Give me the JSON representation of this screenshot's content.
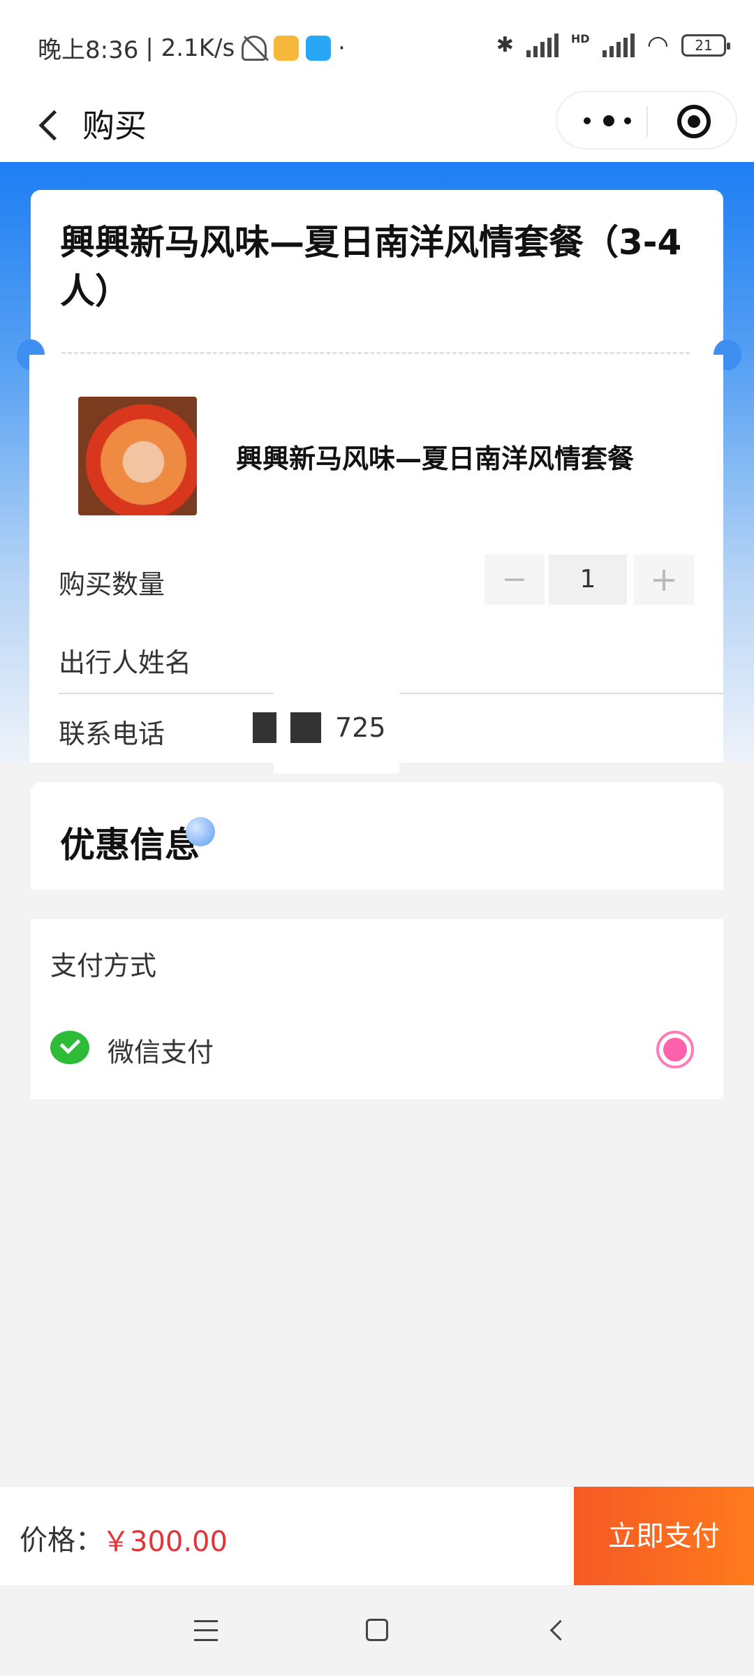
{
  "status_bar": {
    "time": "晚上8:36",
    "speed": "| 2.1K/s",
    "dot": "·",
    "battery": "21",
    "network_badge": "HD"
  },
  "nav": {
    "title": "购买"
  },
  "product": {
    "title": "興興新马风味—夏日南洋风情套餐（3-4人）",
    "item_name": "興興新马风味—夏日南洋风情套餐"
  },
  "form": {
    "quantity_label": "购买数量",
    "quantity_value": "1",
    "minus": "−",
    "plus": "+",
    "traveler_label": "出行人姓名",
    "phone_label": "联系电话",
    "phone_visible_suffix": "725"
  },
  "promo": {
    "title": "优惠信息"
  },
  "payment": {
    "title": "支付方式",
    "method": "微信支付",
    "accent": "#ff62ad"
  },
  "bottom": {
    "price_label": "价格：",
    "price_value": "￥300.00",
    "pay_button": "立即支付",
    "pay_color": "#f55a24"
  }
}
